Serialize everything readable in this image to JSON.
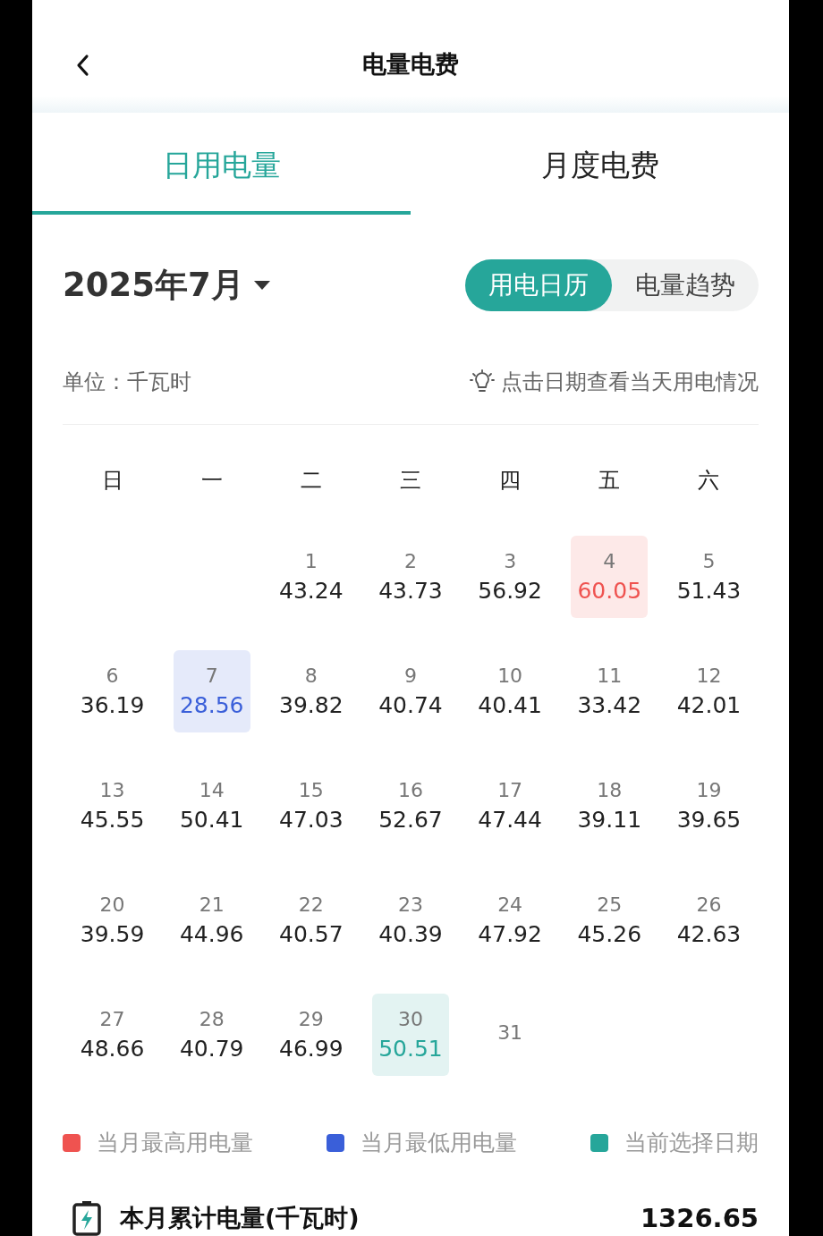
{
  "header": {
    "title": "电量电费"
  },
  "tabs": [
    {
      "label": "日用电量",
      "selected": true
    },
    {
      "label": "月度电费",
      "selected": false
    }
  ],
  "month": {
    "label": "2025年7月"
  },
  "view_toggle": [
    {
      "label": "用电日历",
      "selected": true
    },
    {
      "label": "电量趋势",
      "selected": false
    }
  ],
  "unit": "单位：千瓦时",
  "hint": "点击日期查看当天用电情况",
  "weekdays": [
    "日",
    "一",
    "二",
    "三",
    "四",
    "五",
    "六"
  ],
  "days": [
    {
      "day": "1",
      "value": "43.24"
    },
    {
      "day": "2",
      "value": "43.73"
    },
    {
      "day": "3",
      "value": "56.92"
    },
    {
      "day": "4",
      "value": "60.05",
      "color": "#ef5350"
    },
    {
      "day": "5",
      "value": "51.43"
    },
    {
      "day": "6",
      "value": "36.19"
    },
    {
      "day": "7",
      "value": "28.56",
      "color": "#3a5fd9"
    },
    {
      "day": "8",
      "value": "39.82"
    },
    {
      "day": "9",
      "value": "40.74"
    },
    {
      "day": "10",
      "value": "40.41"
    },
    {
      "day": "11",
      "value": "33.42"
    },
    {
      "day": "12",
      "value": "42.01"
    },
    {
      "day": "13",
      "value": "45.55"
    },
    {
      "day": "14",
      "value": "50.41"
    },
    {
      "day": "15",
      "value": "47.03"
    },
    {
      "day": "16",
      "value": "52.67"
    },
    {
      "day": "17",
      "value": "47.44"
    },
    {
      "day": "18",
      "value": "39.11"
    },
    {
      "day": "19",
      "value": "39.65"
    },
    {
      "day": "20",
      "value": "39.59"
    },
    {
      "day": "21",
      "value": "44.96"
    },
    {
      "day": "22",
      "value": "40.57"
    },
    {
      "day": "23",
      "value": "40.39"
    },
    {
      "day": "24",
      "value": "47.92"
    },
    {
      "day": "25",
      "value": "45.26"
    },
    {
      "day": "26",
      "value": "42.63"
    },
    {
      "day": "27",
      "value": "48.66"
    },
    {
      "day": "28",
      "value": "40.79"
    },
    {
      "day": "29",
      "value": "46.99"
    },
    {
      "day": "30",
      "value": "50.51",
      "color": "#26a69a"
    },
    {
      "day": "31"
    }
  ],
  "legend": [
    {
      "label": "当月最高用电量",
      "color": "#ef5350"
    },
    {
      "label": "当月最低用电量",
      "color": "#3a5fd9"
    },
    {
      "label": "当前选择日期",
      "color": "#26a69a"
    }
  ],
  "total": {
    "label": "本月累计电量(千瓦时)",
    "value": "1326.65"
  }
}
